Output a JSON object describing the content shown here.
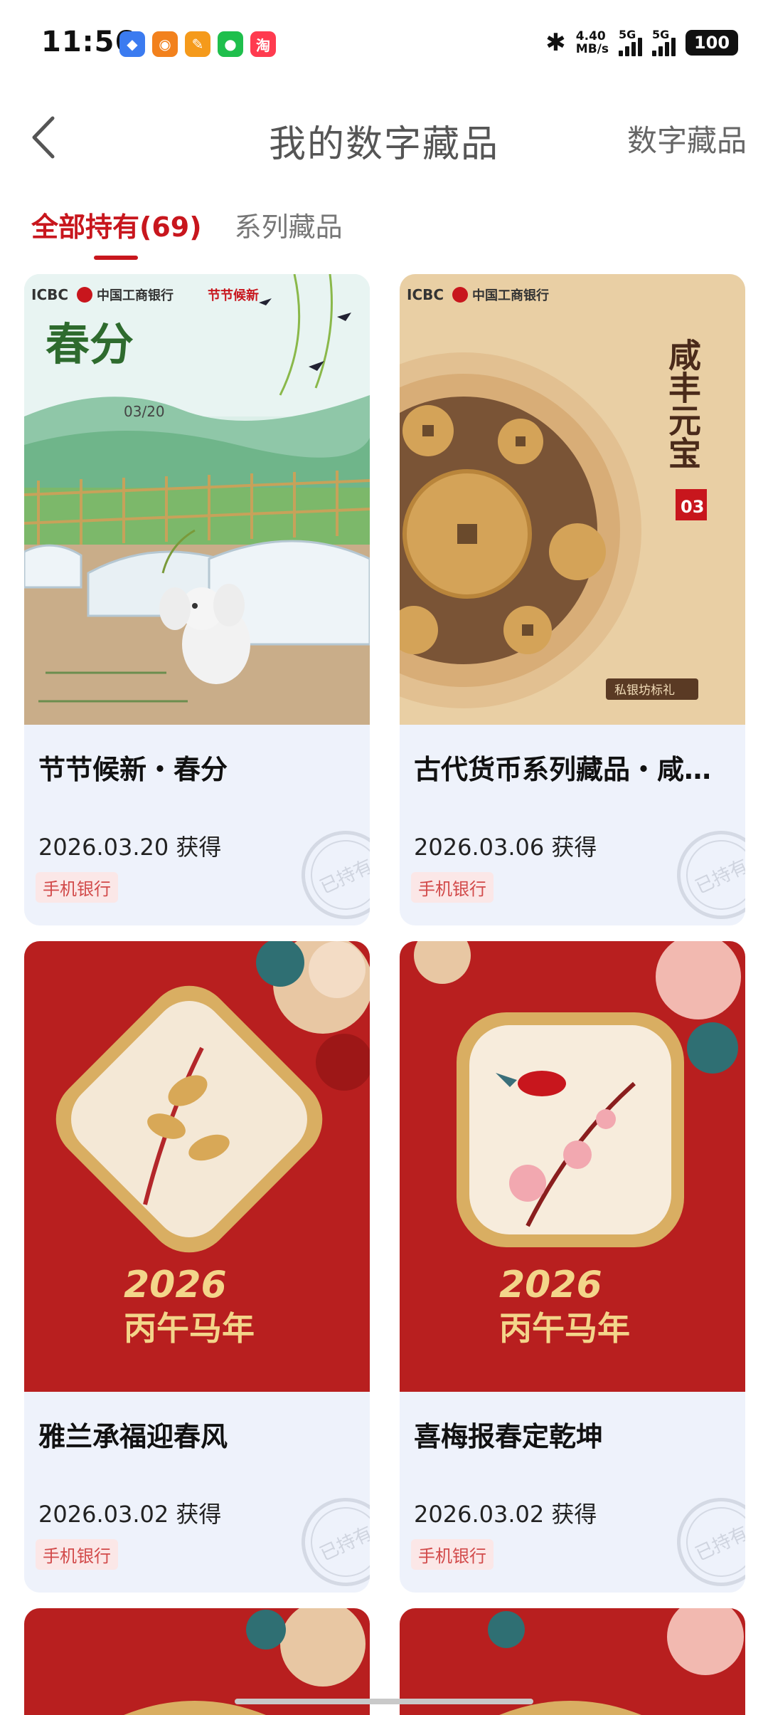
{
  "status_bar": {
    "time": "11:56",
    "app_icons": [
      "app-icon-blue",
      "app-icon-orange",
      "app-icon-orange2",
      "wechat-icon",
      "taobao-icon"
    ],
    "speed_value": "4.40",
    "speed_unit": "MB/s",
    "sim1": "5G",
    "sim2": "5G",
    "battery": "100"
  },
  "header": {
    "title": "我的数字藏品",
    "right_link": "数字藏品"
  },
  "tabs": [
    {
      "label": "全部持有(69)",
      "active": true
    },
    {
      "label": "系列藏品",
      "active": false
    }
  ],
  "cards": [
    {
      "title": "节节候新・春分",
      "date": "2026.03.20 获得",
      "source": "手机银行",
      "stamp": "已持有",
      "art": "spring-equinox-elephant"
    },
    {
      "title": "古代货币系列藏品・咸…",
      "date": "2026.03.06 获得",
      "source": "手机银行",
      "stamp": "已持有",
      "art": "xianfeng-coins"
    },
    {
      "title": "雅兰承福迎春风",
      "date": "2026.03.02 获得",
      "source": "手机银行",
      "stamp": "已持有",
      "art": "orchid-2026-horse"
    },
    {
      "title": "喜梅报春定乾坤",
      "date": "2026.03.02 获得",
      "source": "手机银行",
      "stamp": "已持有",
      "art": "plum-bird-2026-horse"
    }
  ],
  "art_text": {
    "icbc": "ICBC",
    "bank_name": "中国工商银行",
    "jieqi": "节节候新",
    "chunfen": "春分",
    "chunfen_date": "03/20",
    "coin_title": "咸丰元宝",
    "coin_month": "03",
    "coin_note": "私银坊标礼",
    "year_2026": "2026",
    "horse_year": "丙午马年"
  },
  "colors": {
    "accent": "#c8161d",
    "card_bg": "#eef2fb",
    "source_bg": "#fbe7e7"
  }
}
